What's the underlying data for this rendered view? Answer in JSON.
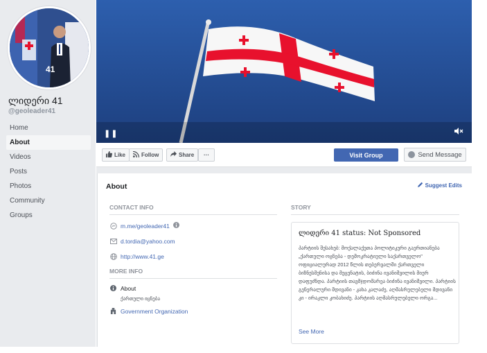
{
  "profile": {
    "name": "ლიდერი 41",
    "handle": "@geoleader41"
  },
  "nav": {
    "items": [
      {
        "label": "Home",
        "active": false
      },
      {
        "label": "About",
        "active": true
      },
      {
        "label": "Videos",
        "active": false
      },
      {
        "label": "Posts",
        "active": false
      },
      {
        "label": "Photos",
        "active": false
      },
      {
        "label": "Community",
        "active": false
      },
      {
        "label": "Groups",
        "active": false
      }
    ]
  },
  "cover": {
    "pause_glyph": "❚❚",
    "mute_glyph": "🔇"
  },
  "actions": {
    "like": "Like",
    "follow": "Follow",
    "share": "Share",
    "more": "···",
    "visit_group": "Visit Group",
    "send_message": "Send Message"
  },
  "about": {
    "title": "About",
    "suggest_edits": "Suggest Edits",
    "contact_title": "CONTACT INFO",
    "messenger": "m.me/geoleader41",
    "email": "d.tordia@yahoo.com",
    "website": "http://www.41.ge",
    "more_info_title": "MORE INFO",
    "about_label": "About",
    "about_value": "ქართული იცნება",
    "category": "Government Organization"
  },
  "story": {
    "section_title": "STORY",
    "title": "ლიდერი 41 status: Not Sponsored",
    "body": "პარტიის შესახებ: მოქალაქეთა პოლიტიკური გაერთიანება „ქართული ოცნება - დემოკრატიული საქართველო\" ოფიციალურად 2012 წლის თებერვალში ქართველი ბიზნესმენისა და მეცენატის, ბიძინა ივანიშვილის მიერ დაფუძნდა. პარტიის თავმჯდომარეა ბიძინა ივანიშვილი. პარტიის გენერალური მდივანი - კახა კალაძე, აღმასრულებელი მდივანი კი - ირაკლი კობახიძე. პარტიის აღმასრულებელი ორგა...",
    "see_more": "See More"
  },
  "colors": {
    "brand_blue": "#4267b2",
    "page_bg": "#e9ebee",
    "flag_red": "#e8112d",
    "sky_blue": "#2a5aa8"
  }
}
